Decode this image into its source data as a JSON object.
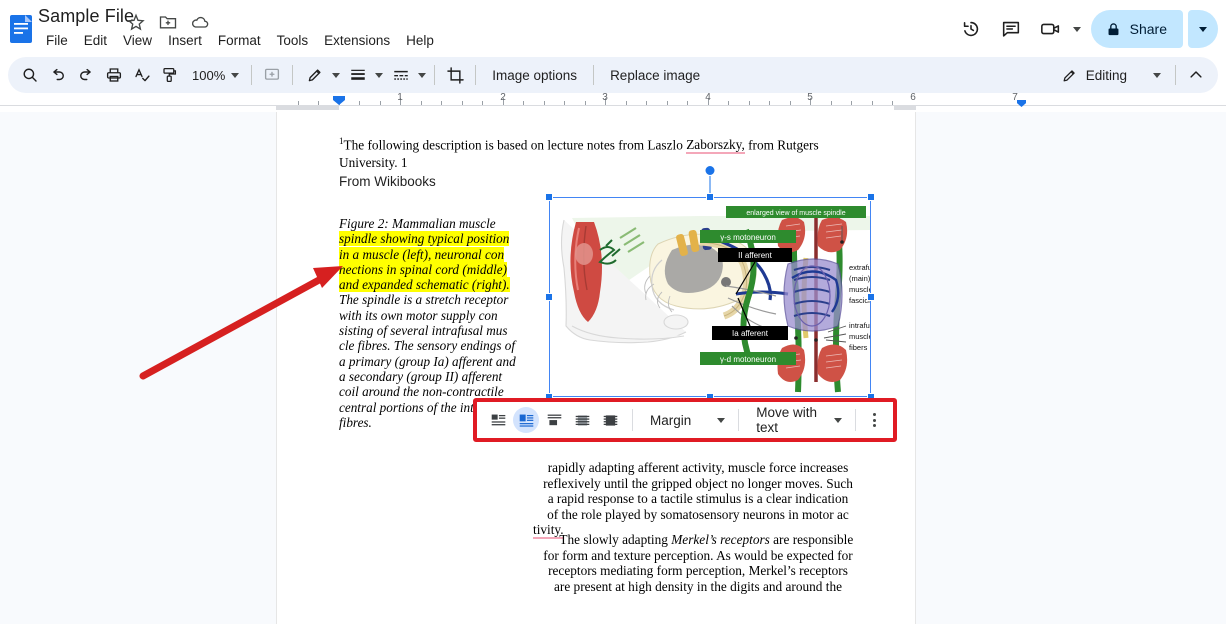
{
  "titlebar": {
    "doc_title": "Sample File",
    "logo_icon": "google-docs-logo",
    "star_icon": "star-icon",
    "move_icon": "move-to-folder-icon",
    "cloud_icon": "cloud-saved-icon",
    "menus": [
      "File",
      "Edit",
      "View",
      "Insert",
      "Format",
      "Tools",
      "Extensions",
      "Help"
    ],
    "history_icon": "version-history-icon",
    "comment_icon": "comment-icon",
    "meet_icon": "video-call-icon",
    "share_label": "Share",
    "share_lock_icon": "lock-icon"
  },
  "toolbar": {
    "search_icon": "search-icon",
    "undo_icon": "undo-icon",
    "redo_icon": "redo-icon",
    "print_icon": "print-icon",
    "spellcheck_icon": "spellcheck-icon",
    "paint_icon": "paint-format-icon",
    "zoom_value": "100%",
    "add_comment_icon": "add-comment-icon",
    "border_color_icon": "pencil-border-color-icon",
    "border_weight_icon": "border-weight-icon",
    "border_dash_icon": "border-dash-icon",
    "crop_icon": "crop-icon",
    "image_options_label": "Image options",
    "replace_image_label": "Replace image",
    "mode_label": "Editing",
    "mode_icon": "pencil-icon",
    "collapse_icon": "chevron-up-icon"
  },
  "ruler": {
    "numbers": [
      "1",
      "2",
      "3",
      "4",
      "5",
      "6",
      "7"
    ]
  },
  "sidebar": {
    "outline_icon": "document-outline-icon"
  },
  "document": {
    "footnote": {
      "sup": "1",
      "before": "The following description is based on lecture notes from Laszlo ",
      "misspelled": "Zaborszky,",
      "after": " from Rutgers University. 1"
    },
    "source_line": "From Wikibooks",
    "caption": {
      "lead": "Figure 2: Mammalian muscle",
      "highlighted": "spindle showing typical position in a muscle (left), neuronal con nections in spinal cord (middle) and expanded schematic (right).",
      "rest": "The spindle is a stretch receptor with its own motor supply con sisting of several intrafusal mus cle fibres. The sensory endings of a primary (group Ia) afferent and a secondary (group II) afferent coil around the non-contractile central portions of the int fibres.",
      "lines": [
        "Figure 2: Mammalian muscle",
        "spindle showing typical position",
        "in a muscle (left), neuronal con",
        "nections in spinal cord (middle)",
        "and expanded schematic (right).",
        "The spindle is a stretch receptor",
        "with its own motor supply con",
        "sisting of several intrafusal mus",
        "cle fibres. The sensory endings of",
        "a primary (group Ia) afferent and",
        "a secondary (group II) afferent",
        "coil around the non-contractile",
        "central portions of the int",
        "fibres."
      ],
      "highlight_color": "#ffff00"
    },
    "body_para_1_lines": [
      "rapidly adapting afferent activity, muscle force increases",
      "reflexively until the gripped object no longer moves. Such",
      "a rapid response to a tactile stimulus is a clear indication",
      "of the role played by somatosensory neurons in motor ac",
      "tivity."
    ],
    "body_para_1_misspelled": "tivity.",
    "body_para_2_lines": [
      "The slowly adapting Merkel’s receptors are responsible",
      "for form and texture perception. As would be expected for",
      "receptors mediating form perception, Merkel’s receptors",
      "are present at high density in the digits and around the"
    ],
    "body_para_2_italic": "Merkel’s receptors"
  },
  "image": {
    "alt": "muscle-spindle-diagram",
    "labels": {
      "banner": "enlarged view of muscle spindle",
      "gamma_s": "γ-s motoneuron",
      "afferent_ii": "II afferent",
      "afferent_ia": "Ia afferent",
      "gamma_d": "γ-d motoneuron",
      "extrafusal": [
        "extrafusal",
        "(main)",
        "muscle",
        "fascicles"
      ],
      "intrafusal": [
        "intrafusal",
        "muscle",
        "fibers"
      ]
    },
    "selected": true
  },
  "image_toolbar": {
    "wrap_icons": [
      "inline-with-text-icon",
      "wrap-text-icon",
      "break-text-icon",
      "behind-text-icon",
      "in-front-of-text-icon"
    ],
    "selected_wrap_index": 1,
    "margin_label": "Margin",
    "position_label": "Move with text",
    "more_icon": "more-options-kebab-icon",
    "highlight_color": "#e01b24"
  },
  "annotation": {
    "arrow_color": "#d62020"
  }
}
